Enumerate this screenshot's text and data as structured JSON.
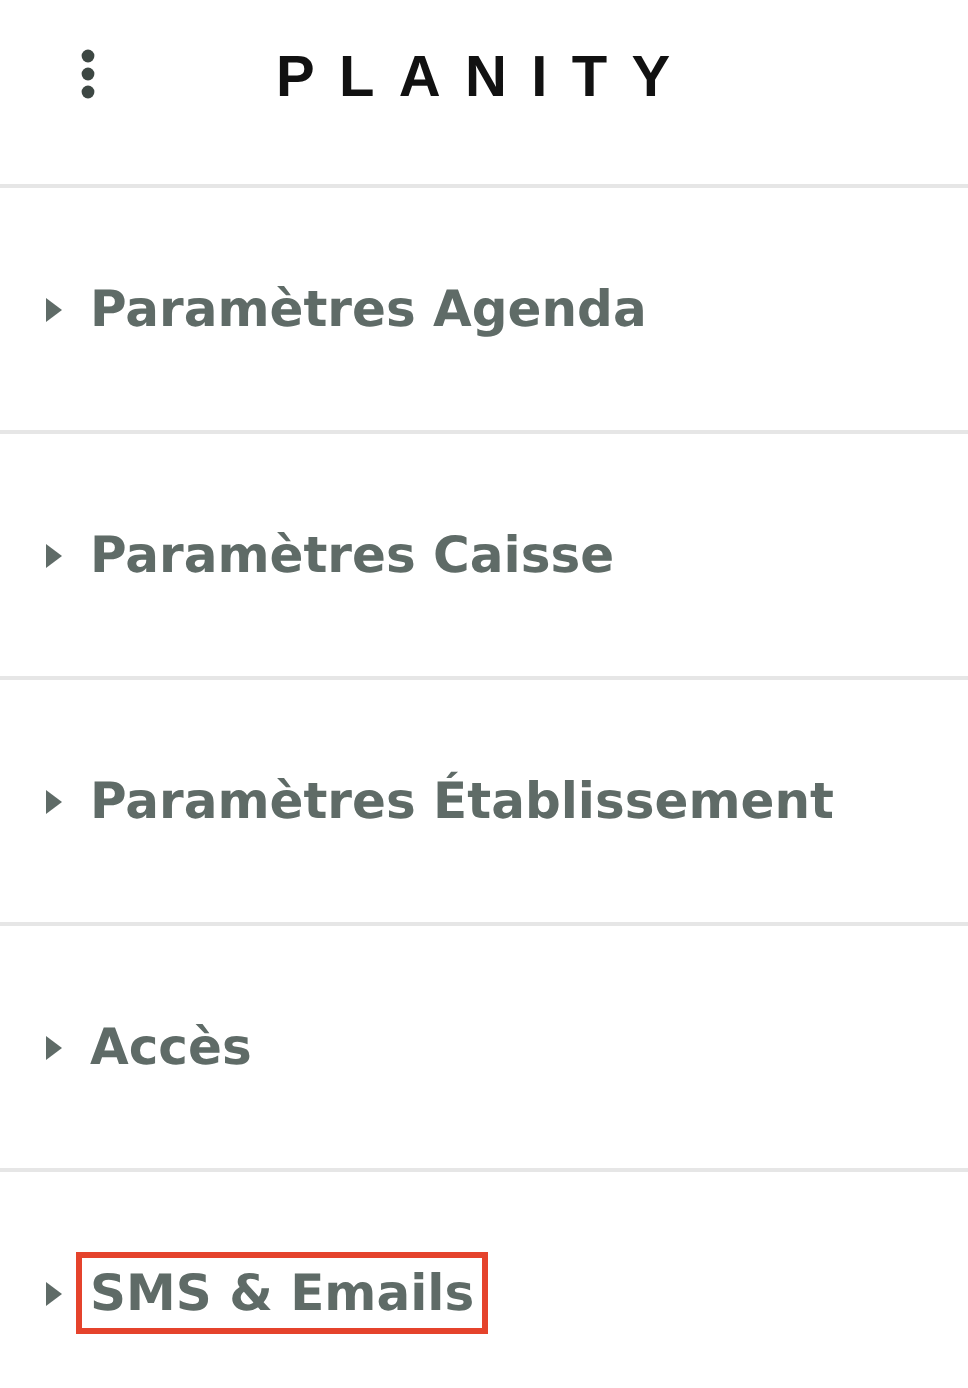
{
  "header": {
    "logo": "PLANITY"
  },
  "menu": [
    {
      "label": "Paramètres Agenda",
      "expanded": false,
      "highlighted": false
    },
    {
      "label": "Paramètres Caisse",
      "expanded": false,
      "highlighted": false
    },
    {
      "label": "Paramètres Établissement",
      "expanded": false,
      "highlighted": false
    },
    {
      "label": "Accès",
      "expanded": false,
      "highlighted": false
    },
    {
      "label": "SMS & Emails",
      "expanded": false,
      "highlighted": true
    }
  ]
}
